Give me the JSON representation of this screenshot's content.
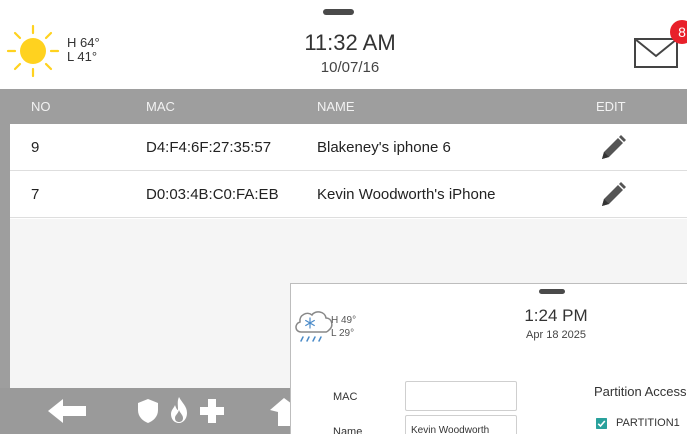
{
  "header": {
    "weather": {
      "icon": "sun-icon",
      "high": "H 64°",
      "low": "L 41°"
    },
    "time": "11:32 AM",
    "date": "10/07/16",
    "mail": {
      "icon": "envelope-icon",
      "badge_count": "8"
    }
  },
  "table": {
    "columns": [
      "NO",
      "MAC",
      "NAME",
      "EDIT"
    ],
    "rows": [
      {
        "no": "9",
        "mac": "D4:F4:6F:27:35:57",
        "name": "Blakeney's iphone 6",
        "edit_icon": "pencil-icon"
      },
      {
        "no": "7",
        "mac": "D0:03:4B:C0:FA:EB",
        "name": "Kevin Woodworth's iPhone",
        "edit_icon": "pencil-icon"
      }
    ]
  },
  "navbar": {
    "items": [
      "back-arrow-icon",
      "shield-icon",
      "fire-icon",
      "medical-cross-icon",
      "home-icon"
    ]
  },
  "overlay": {
    "weather": {
      "icon": "snow-rain-cloud-icon",
      "high": "H 49°",
      "low": "L 29°"
    },
    "time": "1:24 PM",
    "date": "Apr 18 2025",
    "form": {
      "mac_label": "MAC",
      "mac_value": "",
      "name_label": "Name",
      "name_value": "Kevin Woodworth"
    },
    "partition": {
      "title": "Partition Access",
      "items": [
        {
          "label": "PARTITION1",
          "checked": true
        }
      ]
    }
  },
  "colors": {
    "header_bar": "#9e9e9e",
    "badge": "#e8202a",
    "sun": "#ffd21f",
    "checkbox": "#29a19c"
  }
}
